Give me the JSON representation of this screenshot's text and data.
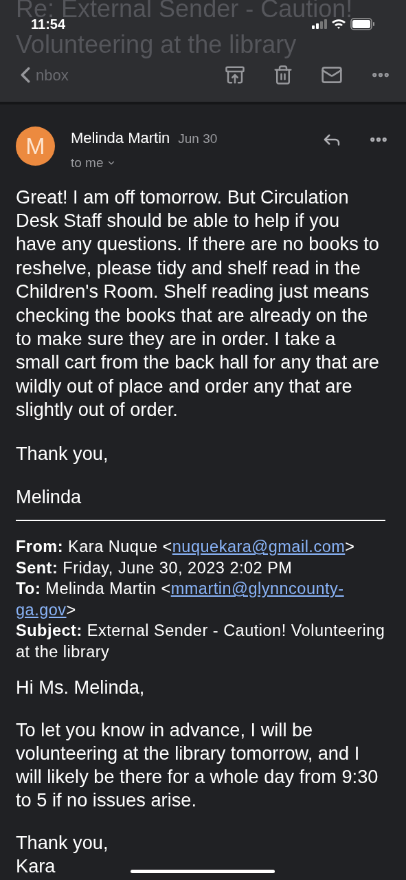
{
  "status_bar": {
    "time": "11:54"
  },
  "subject_title": [
    "Re: External Sender - Caution!",
    "Volunteering at the library"
  ],
  "toolbar": {
    "back_label": "nbox"
  },
  "message": {
    "avatar_letter": "M",
    "sender": "Melinda Martin",
    "date": "Jun 30",
    "recipient": "to me",
    "body": [
      "Great! I am off tomorrow. But Circulation Desk Staff should be able to help if you have any questions. If there are no books to reshelve, please tidy and shelf read in the Children's Room. Shelf reading just means checking the books that are already on the to make sure they are in order. I take a small cart from the back hall for any that are wildly out of place and order any that are slightly out of order.",
      "Thank you,",
      "Melinda"
    ],
    "quoted_header": [
      {
        "label": "From:",
        "before": "Kara Nuque <",
        "link_lines": [
          "nuquekara@gmail.com"
        ],
        "after": ">"
      },
      {
        "label": "Sent:",
        "before": "Friday, June 30, 2023 2:02 PM"
      },
      {
        "label": "To:",
        "before": "Melinda Martin <",
        "link_lines": [
          "mmartin@glynncounty-",
          "ga.gov"
        ],
        "after": ">"
      },
      {
        "label": "Subject:",
        "before": "External Sender - Caution! Volunteering at the library"
      }
    ],
    "quoted_body": [
      [
        "Hi Ms. Melinda,"
      ],
      [
        "To let you know in advance, I will be volunteering at the library tomorrow, and I will likely be there for a whole day from 9:30 to 5 if no issues arise."
      ],
      [
        "Thank you,",
        "Kara"
      ]
    ]
  }
}
